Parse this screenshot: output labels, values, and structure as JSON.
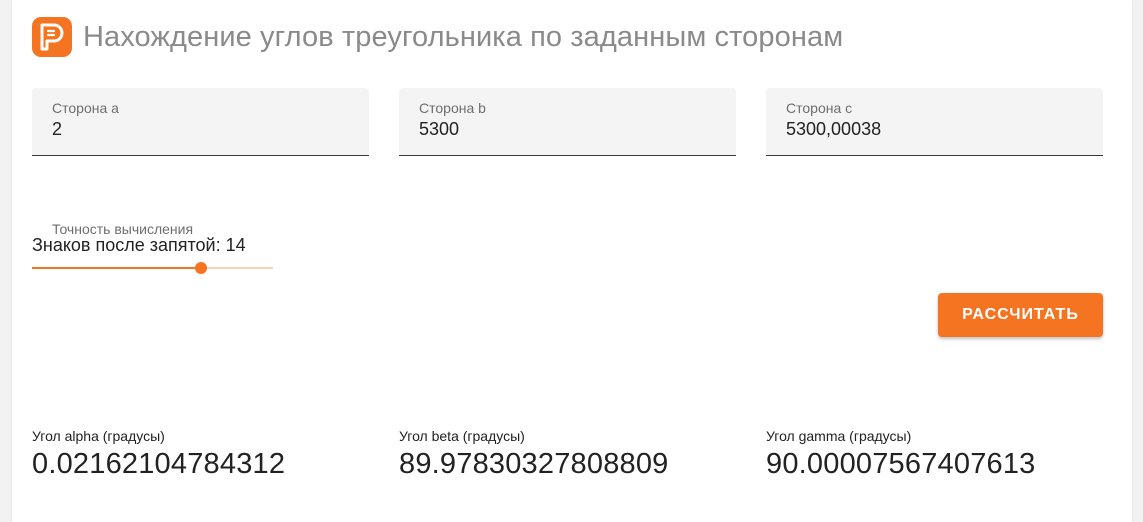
{
  "header": {
    "title": "Нахождение углов треугольника по заданным сторонам",
    "logo_color": "#f47421",
    "logo_icon": "p-logo-icon"
  },
  "inputs": {
    "side_a": {
      "label": "Сторона a",
      "value": "2"
    },
    "side_b": {
      "label": "Сторона b",
      "value": "5300"
    },
    "side_c": {
      "label": "Сторона c",
      "value": "5300,00038"
    }
  },
  "precision": {
    "label": "Точность вычисления",
    "text": "Знаков после запятой: 14",
    "value": 14,
    "min": 0,
    "max": 20
  },
  "actions": {
    "calculate_label": "РАССЧИТАТЬ"
  },
  "results": {
    "alpha": {
      "label": "Угол alpha (градусы)",
      "value": "0.02162104784312"
    },
    "beta": {
      "label": "Угол beta (градусы)",
      "value": "89.97830327808809"
    },
    "gamma": {
      "label": "Угол gamma (градусы)",
      "value": "90.00007567407613"
    }
  },
  "colors": {
    "accent": "#f47421"
  }
}
